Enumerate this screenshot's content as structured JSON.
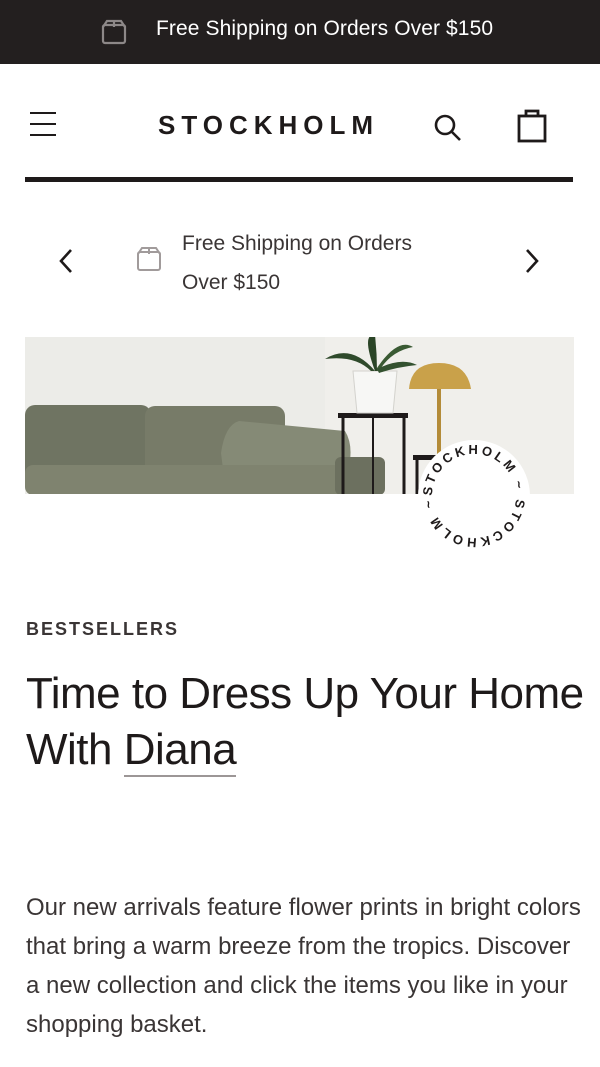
{
  "topbar": {
    "icon": "package-box-icon",
    "message": "Free Shipping on Orders Over $150",
    "background": "#231f1f"
  },
  "header": {
    "menu_icon": "hamburger-menu-icon",
    "logo": "STOCKHOLM",
    "search_icon": "search-icon",
    "cart_icon": "shopping-bag-icon"
  },
  "announcement": {
    "prev_icon": "chevron-left-icon",
    "next_icon": "chevron-right-icon",
    "icon": "package-box-icon",
    "message": "Free Shipping on Orders Over $150"
  },
  "hero": {
    "stamp_text": "STOCKHOLM ~ STOCKHOLM ~ "
  },
  "section": {
    "eyebrow": "BESTSELLERS",
    "heading_prefix": "Time to Dress Up Your Home With ",
    "heading_link": "Diana",
    "paragraph": "Our new arrivals feature flower prints in bright colors that bring a warm breeze from the tropics. Discover a new collection and click the items you like in your shopping basket."
  },
  "colors": {
    "text": "#1e1a1a",
    "muted": "#3a3535",
    "sofa": "#7c7f6c",
    "lamp": "#c9a14a"
  }
}
